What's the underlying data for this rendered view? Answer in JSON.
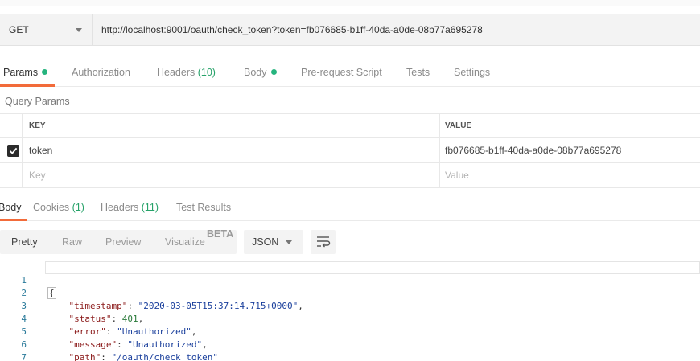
{
  "request": {
    "method": "GET",
    "url": "http://localhost:9001/oauth/check_token?token=fb076685-b1ff-40da-a0de-08b77a695278"
  },
  "request_tabs": {
    "params": "Params",
    "authorization": "Authorization",
    "headers": "Headers",
    "headers_count": "(10)",
    "body": "Body",
    "prerequest": "Pre-request Script",
    "tests": "Tests",
    "settings": "Settings"
  },
  "query_params": {
    "title": "Query Params",
    "key_header": "KEY",
    "value_header": "VALUE",
    "rows": [
      {
        "checked": true,
        "key": "token",
        "value": "fb076685-b1ff-40da-a0de-08b77a695278"
      }
    ],
    "key_placeholder": "Key",
    "value_placeholder": "Value"
  },
  "response_tabs": {
    "body": "Body",
    "cookies": "Cookies",
    "cookies_count": "(1)",
    "headers": "Headers",
    "headers_count": "(11)",
    "test_results": "Test Results"
  },
  "response_toolbar": {
    "pretty": "Pretty",
    "raw": "Raw",
    "preview": "Preview",
    "visualize": "Visualize",
    "beta": "BETA",
    "format": "JSON"
  },
  "response_body": {
    "line_numbers": [
      "1",
      "2",
      "3",
      "4",
      "5",
      "6",
      "7"
    ],
    "open_brace": "{",
    "close_brace": "}",
    "fields": [
      {
        "key": "\"timestamp\"",
        "value": "\"2020-03-05T15:37:14.715+0000\"",
        "type": "string"
      },
      {
        "key": "\"status\"",
        "value": "401",
        "type": "number"
      },
      {
        "key": "\"error\"",
        "value": "\"Unauthorized\"",
        "type": "string"
      },
      {
        "key": "\"message\"",
        "value": "\"Unauthorized\"",
        "type": "string"
      },
      {
        "key": "\"path\"",
        "value_prefix": "\"",
        "value": "/oauth/check_token",
        "value_suffix": "\"",
        "type": "link"
      }
    ]
  },
  "colors": {
    "accent": "#f26b3a",
    "status_dot": "#26b47e",
    "beta": "#2a7fd6"
  }
}
